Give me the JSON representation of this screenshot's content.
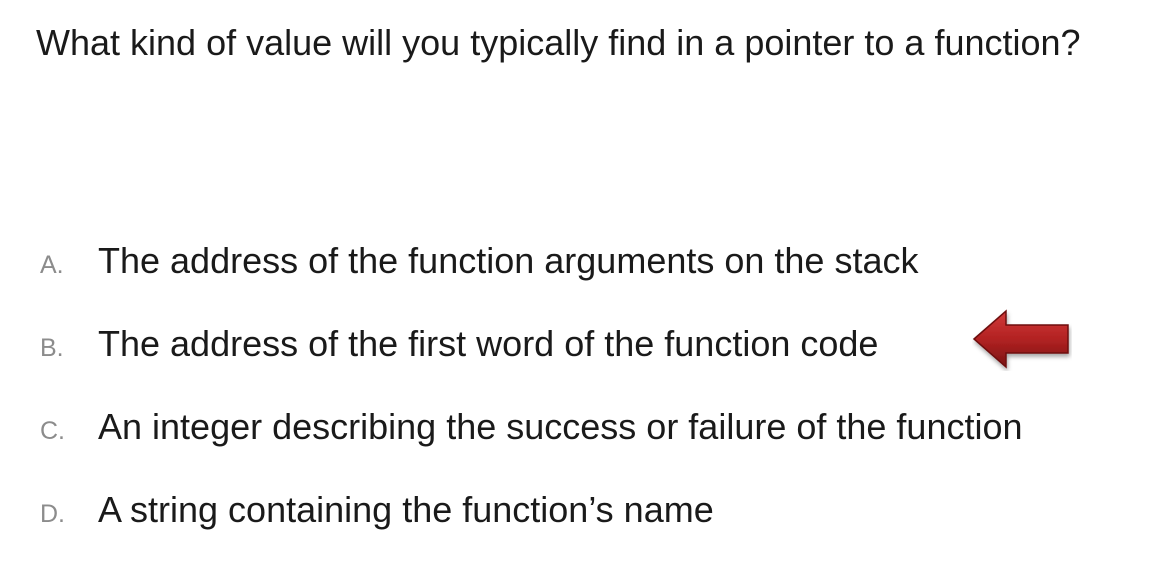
{
  "question": {
    "text": "What kind of value will you typically find in a pointer to a function?"
  },
  "options": [
    {
      "letter": "A.",
      "text": "The address of the function arguments on the stack",
      "marked": false
    },
    {
      "letter": "B.",
      "text": "The address of the first word of the function code",
      "marked": true
    },
    {
      "letter": "C.",
      "text": "An integer describing the success or failure of the function",
      "marked": false
    },
    {
      "letter": "D.",
      "text": "A string containing the function’s name",
      "marked": false
    }
  ],
  "colors": {
    "text": "#1a1a1a",
    "option_letter": "#8c8c8c",
    "arrow": "#b22222",
    "arrow_dark": "#7a1414"
  },
  "icons": {
    "answer_marker": "left-arrow-icon"
  }
}
